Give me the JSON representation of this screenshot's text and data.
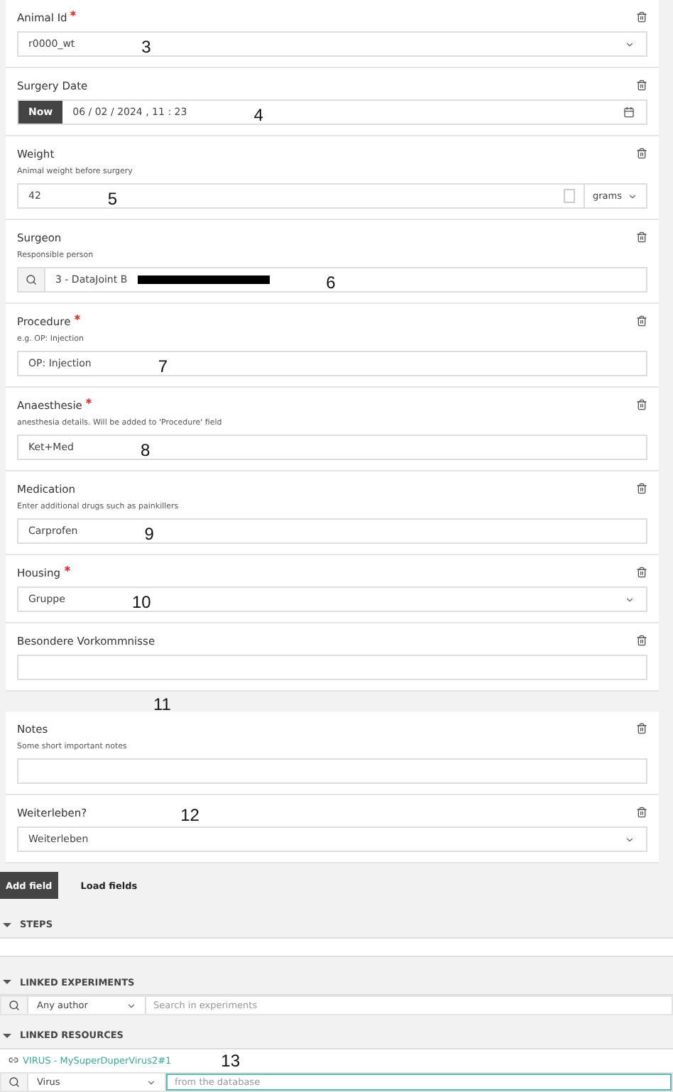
{
  "fields": [
    {
      "kind": "select",
      "label": "Animal Id",
      "required": true,
      "value": "r0000_wt",
      "annotation": "3"
    },
    {
      "kind": "datetime",
      "label": "Surgery Date",
      "required": false,
      "button": "Now",
      "value": "06 / 02 / 2024 ,  11 : 23",
      "annotation": "4"
    },
    {
      "kind": "number",
      "label": "Weight",
      "required": false,
      "help": "Animal weight before surgery",
      "value": "42",
      "unit": "grams",
      "annotation": "5"
    },
    {
      "kind": "search",
      "label": "Surgeon",
      "required": false,
      "help": "Responsible person",
      "value": "3 - DataJoint B",
      "redacted": true,
      "annotation": "6"
    },
    {
      "kind": "text",
      "label": "Procedure",
      "required": true,
      "help": "e.g. OP: Injection",
      "value": "OP: Injection",
      "annotation": "7"
    },
    {
      "kind": "text",
      "label": "Anaesthesie",
      "required": true,
      "help": "anesthesia details. Will be added to 'Procedure' field",
      "value": "Ket+Med",
      "annotation": "8"
    },
    {
      "kind": "text",
      "label": "Medication",
      "required": false,
      "help": "Enter additional drugs such as painkillers",
      "value": "Carprofen",
      "annotation": "9"
    },
    {
      "kind": "select",
      "label": "Housing",
      "required": true,
      "value": "Gruppe",
      "annotation": "10"
    },
    {
      "kind": "text",
      "label": "Besondere Vorkommnisse",
      "required": false,
      "annotation_below": "11"
    },
    {
      "kind": "text",
      "label": "Notes",
      "required": false,
      "help": "Some short important notes"
    },
    {
      "kind": "select",
      "label": "Weiterleben?",
      "required": false,
      "value": "Weiterleben",
      "label_annotation": "12"
    }
  ],
  "actions": [
    {
      "label": "Add field",
      "primary": true
    },
    {
      "label": "Load fields",
      "primary": false
    }
  ],
  "steps": {
    "title": "STEPS",
    "expanded": true
  },
  "linked_experiments": {
    "title": "LINKED EXPERIMENTS",
    "expanded": true,
    "author": "Any author",
    "placeholder": "Search in experiments"
  },
  "linked_resources": {
    "title": "LINKED RESOURCES",
    "expanded": true,
    "link": "VIRUS - MySuperDuperVirus2#1",
    "annotation": "13",
    "category": "Virus",
    "placeholder": "from the database"
  }
}
